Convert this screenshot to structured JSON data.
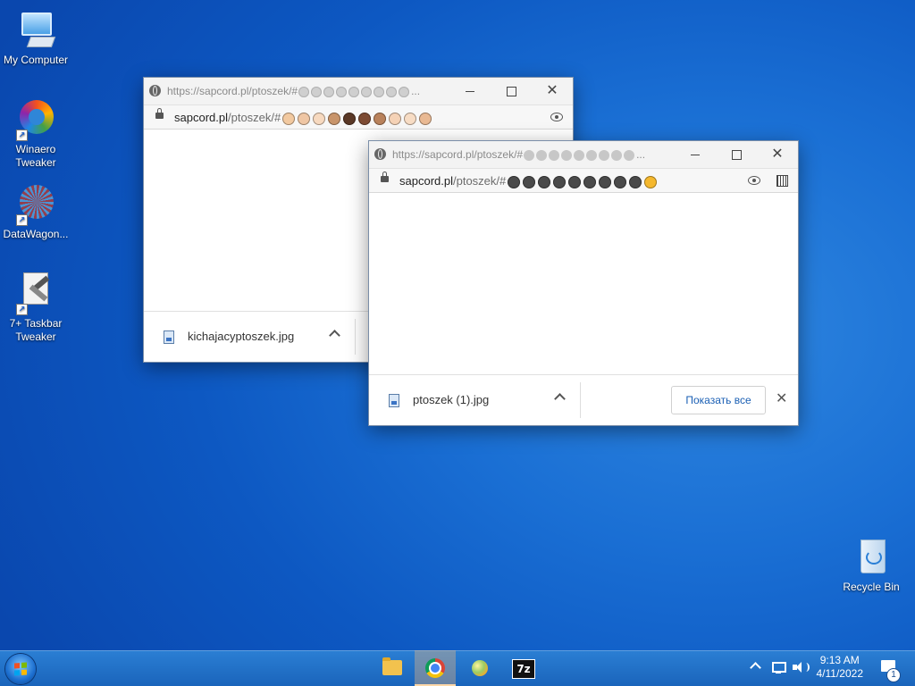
{
  "desktop": {
    "icons": [
      {
        "label": "My Computer"
      },
      {
        "label": "Winaero Tweaker"
      },
      {
        "label": "DataWagon..."
      },
      {
        "label": "7+ Taskbar Tweaker"
      },
      {
        "label": "Recycle Bin"
      }
    ]
  },
  "window_back": {
    "title_url": "https://sapcord.pl/ptoszek/#",
    "title_ellipsis": "...",
    "address_host": "sapcord.pl",
    "address_path": "/ptoszek/#",
    "emoji_colors": [
      "#f2c9a0",
      "#efc6a4",
      "#f7d9bf",
      "#c8946a",
      "#5a3826",
      "#7d4b33",
      "#b9825c",
      "#f5d2b6",
      "#f7dcc4",
      "#e9b993"
    ],
    "download": {
      "filename": "kichajacyptoszek.jpg"
    }
  },
  "window_front": {
    "title_url": "https://sapcord.pl/ptoszek/#",
    "title_ellipsis": "...",
    "address_host": "sapcord.pl",
    "address_path": "/ptoszek/#",
    "emoji_colors": [
      "#4a4a4a",
      "#4a4a4a",
      "#4a4a4a",
      "#4a4a4a",
      "#4a4a4a",
      "#4a4a4a",
      "#4a4a4a",
      "#4a4a4a",
      "#4a4a4a",
      "#f5b82e"
    ],
    "download": {
      "filename": "ptoszek (1).jpg",
      "show_all": "Показать все"
    }
  },
  "taskbar": {
    "clock_time": "9:13 AM",
    "clock_date": "4/11/2022",
    "notification_count": "1",
    "zip_label": "7z"
  }
}
